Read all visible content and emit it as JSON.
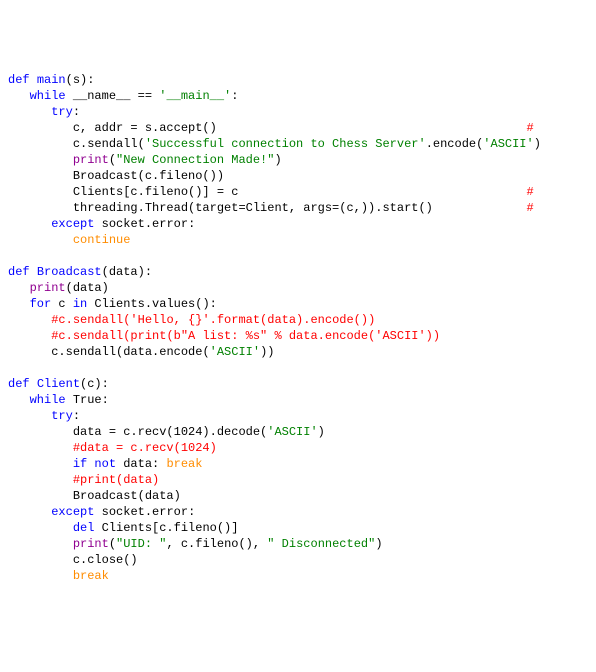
{
  "code": {
    "l01": {
      "def": "def",
      "sp": " ",
      "fn": "main",
      "paren": "(s):"
    },
    "l02": {
      "ind": "   ",
      "kw1": "while",
      "sp1": " ",
      "name": "__name__",
      "sp2": " == ",
      "str": "'__main__'",
      "colon": ":"
    },
    "l03": {
      "ind": "      ",
      "kw": "try",
      "colon": ":"
    },
    "l04": {
      "ind": "         ",
      "txt": "c, addr = s.accept()",
      "pad": "                                           ",
      "cmt": "# "
    },
    "l05": {
      "ind": "         ",
      "a": "c.sendall(",
      "str": "'Successful connection to Chess Server'",
      "b": ".encode(",
      "str2": "'ASCII'",
      "c": ")"
    },
    "l06": {
      "ind": "         ",
      "print": "print",
      "a": "(",
      "str": "\"New Connection Made!\"",
      "b": ")"
    },
    "l07": {
      "ind": "         ",
      "txt": "Broadcast(c.fileno())"
    },
    "l08": {
      "ind": "         ",
      "txt": "Clients[c.fileno()] = c",
      "pad": "                                        ",
      "cmt": "#"
    },
    "l09": {
      "ind": "         ",
      "txt": "threading.Thread(target=Client, args=(c,)).start()",
      "pad": "             ",
      "cmt": "# "
    },
    "l10": {
      "ind": "      ",
      "kw": "except",
      "sp": " ",
      "name": "socket.error",
      "colon": ":"
    },
    "l11": {
      "ind": "         ",
      "kw": "continue"
    },
    "l12": {
      "blank": ""
    },
    "l13": {
      "def": "def",
      "sp": " ",
      "fn": "Broadcast",
      "paren": "(data):"
    },
    "l14": {
      "ind": "   ",
      "print": "print",
      "a": "(data)"
    },
    "l15": {
      "ind": "   ",
      "kw1": "for",
      "sp1": " c ",
      "kw2": "in",
      "sp2": " Clients.values():"
    },
    "l16": {
      "ind": "      ",
      "cmt": "#c.sendall('Hello, {}'.format(data).encode())"
    },
    "l17": {
      "ind": "      ",
      "cmt": "#c.sendall(print(b\"A list: %s\" % data.encode('ASCII'))"
    },
    "l18": {
      "ind": "      ",
      "a": "c.sendall(data.encode(",
      "str": "'ASCII'",
      "b": "))"
    },
    "l19": {
      "blank": ""
    },
    "l20": {
      "def": "def",
      "sp": " ",
      "fn": "Client",
      "paren": "(c):"
    },
    "l21": {
      "ind": "   ",
      "kw": "while",
      "sp": " ",
      "name": "True",
      "colon": ":"
    },
    "l22": {
      "ind": "      ",
      "kw": "try",
      "colon": ":"
    },
    "l23": {
      "ind": "         ",
      "a": "data = c.recv(1024).decode(",
      "str": "'ASCII'",
      "b": ")"
    },
    "l24": {
      "ind": "         ",
      "cmt": "#data = c.recv(1024)"
    },
    "l25": {
      "ind": "         ",
      "kw1": "if",
      "sp1": " ",
      "kw2": "not",
      "sp2": " data: ",
      "kw3": "break"
    },
    "l26": {
      "ind": "         ",
      "cmt": "#print(data)"
    },
    "l27": {
      "ind": "         ",
      "txt": "Broadcast(data)"
    },
    "l28": {
      "ind": "      ",
      "kw": "except",
      "sp": " ",
      "name": "socket.error",
      "colon": ":"
    },
    "l29": {
      "ind": "         ",
      "kw": "del",
      "sp": " ",
      "txt": "Clients[c.fileno()]"
    },
    "l30": {
      "ind": "         ",
      "print": "print",
      "a": "(",
      "str": "\"UID: \"",
      "b": ", c.fileno(), ",
      "str2": "\" Disconnected\"",
      "c": ")"
    },
    "l31": {
      "ind": "         ",
      "txt": "c.close()"
    },
    "l32": {
      "ind": "         ",
      "kw": "break"
    }
  }
}
